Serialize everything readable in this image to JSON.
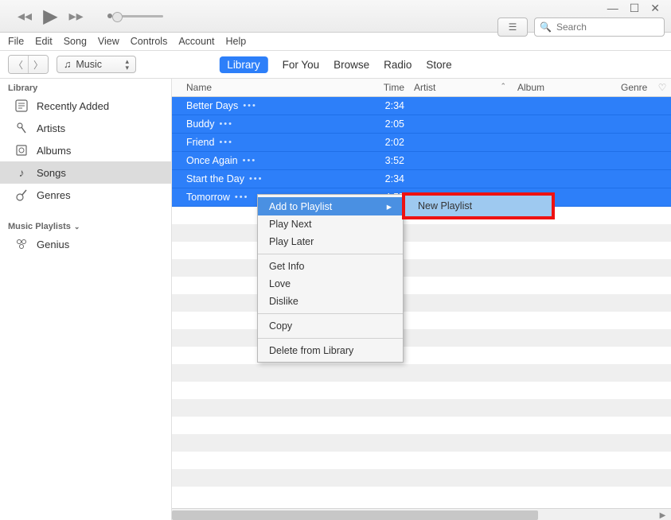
{
  "search": {
    "placeholder": "Search"
  },
  "menubar": [
    "File",
    "Edit",
    "Song",
    "View",
    "Controls",
    "Account",
    "Help"
  ],
  "source_select": {
    "label": "Music"
  },
  "tabs": [
    {
      "label": "Library",
      "active": true
    },
    {
      "label": "For You",
      "active": false
    },
    {
      "label": "Browse",
      "active": false
    },
    {
      "label": "Radio",
      "active": false
    },
    {
      "label": "Store",
      "active": false
    }
  ],
  "sidebar": {
    "library_header": "Library",
    "library_items": [
      {
        "label": "Recently Added",
        "icon": "clock"
      },
      {
        "label": "Artists",
        "icon": "mic"
      },
      {
        "label": "Albums",
        "icon": "album"
      },
      {
        "label": "Songs",
        "icon": "note",
        "selected": true
      },
      {
        "label": "Genres",
        "icon": "guitar"
      }
    ],
    "playlists_header": "Music Playlists",
    "playlist_items": [
      {
        "label": "Genius",
        "icon": "genius"
      }
    ]
  },
  "columns": {
    "name": "Name",
    "time": "Time",
    "artist": "Artist",
    "album": "Album",
    "genre": "Genre"
  },
  "songs": [
    {
      "name": "Better Days",
      "time": "2:34"
    },
    {
      "name": "Buddy",
      "time": "2:05"
    },
    {
      "name": "Friend",
      "time": "2:02"
    },
    {
      "name": "Once Again",
      "time": "3:52"
    },
    {
      "name": "Start the Day",
      "time": "2:34"
    },
    {
      "name": "Tomorrow",
      "time": "4:55"
    }
  ],
  "context_menu": {
    "items": [
      {
        "label": "Add to Playlist",
        "submenu": true,
        "highlighted": true
      },
      {
        "label": "Play Next"
      },
      {
        "label": "Play Later"
      },
      {
        "sep": true
      },
      {
        "label": "Get Info"
      },
      {
        "label": "Love"
      },
      {
        "label": "Dislike"
      },
      {
        "sep": true
      },
      {
        "label": "Copy"
      },
      {
        "sep": true
      },
      {
        "label": "Delete from Library"
      }
    ]
  },
  "submenu": {
    "label": "New Playlist"
  }
}
